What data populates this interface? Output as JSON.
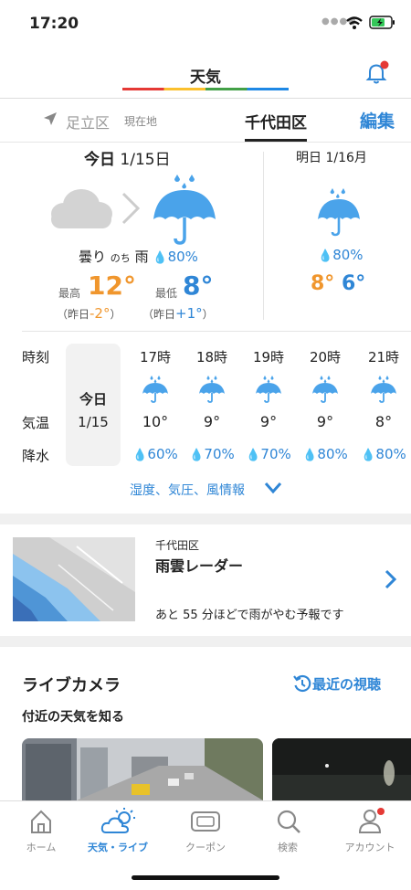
{
  "status": {
    "time": "17:20",
    "dots": "●●●●"
  },
  "header": {
    "title": "天気"
  },
  "tabs": {
    "current_location": "足立区",
    "current_label": "現在地",
    "selected": "千代田区",
    "edit": "編集"
  },
  "today": {
    "date_prefix": "今日",
    "date": "1/15日",
    "condition": "曇り",
    "condition_suffix": "のち",
    "condition_next": "雨",
    "precip": "80%",
    "high_label": "最高",
    "high": "12°",
    "high_diff_prefix": "（昨日",
    "high_diff": "-2°",
    "high_diff_suffix": "）",
    "low_label": "最低",
    "low": "8°",
    "low_diff_prefix": "（昨日",
    "low_diff": "+1°",
    "low_diff_suffix": "）"
  },
  "tomorrow": {
    "date": "明日 1/16月",
    "precip": "80%",
    "high": "8°",
    "low": "6°"
  },
  "hourly": {
    "row_labels": {
      "time": "時刻",
      "temp": "気温",
      "precip": "降水"
    },
    "day_label": "今日",
    "day_date": "1/15",
    "hours": [
      {
        "time": "17時",
        "temp": "10°",
        "precip": "60%"
      },
      {
        "time": "18時",
        "temp": "9°",
        "precip": "70%"
      },
      {
        "time": "19時",
        "temp": "9°",
        "precip": "70%"
      },
      {
        "time": "20時",
        "temp": "9°",
        "precip": "80%"
      },
      {
        "time": "21時",
        "temp": "8°",
        "precip": "80%"
      }
    ],
    "more": "湿度、気圧、風情報"
  },
  "radar": {
    "area": "千代田区",
    "title": "雨雲レーダー",
    "message": "あと 55 分ほどで雨がやむ予報です"
  },
  "camera": {
    "title": "ライブカメラ",
    "recent": "最近の視聴",
    "subtitle": "付近の天気を知る"
  },
  "nav": [
    {
      "label": "ホーム",
      "icon": "home-icon"
    },
    {
      "label": "天気・ライブ",
      "icon": "weather-icon"
    },
    {
      "label": "クーポン",
      "icon": "coupon-icon"
    },
    {
      "label": "検索",
      "icon": "search-icon"
    },
    {
      "label": "アカウント",
      "icon": "account-icon"
    }
  ],
  "colors": {
    "accent": "#2f86d6",
    "orange": "#f0962d",
    "badge": "#e53935"
  }
}
